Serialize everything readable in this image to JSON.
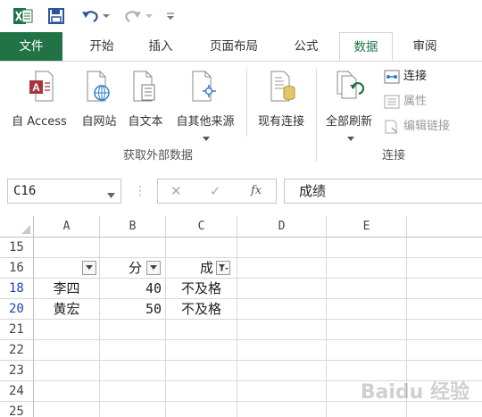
{
  "qat": {
    "icons": [
      "excel-logo-icon",
      "save-icon",
      "undo-icon",
      "redo-icon",
      "customize-qat-icon"
    ]
  },
  "tabs": [
    "文件",
    "开始",
    "插入",
    "页面布局",
    "公式",
    "数据",
    "审阅"
  ],
  "active_tab": "数据",
  "ribbon": {
    "get_external": {
      "from_access": "自 Access",
      "from_web": "自网站",
      "from_text": "自文本",
      "from_other": "自其他来源",
      "group_label": "获取外部数据"
    },
    "existing_connections": "现有连接",
    "connections": {
      "refresh_all": "全部刷新",
      "connections": "连接",
      "properties": "属性",
      "edit_links": "编辑链接",
      "group_label": "连接"
    }
  },
  "formula_bar": {
    "name_box": "C16",
    "cancel_glyph": "✕",
    "enter_glyph": "✓",
    "fx_glyph": "fx",
    "content": "成绩"
  },
  "grid": {
    "columns": [
      "A",
      "B",
      "C",
      "D",
      "E"
    ],
    "rows": [
      {
        "num": "15",
        "filtered": false,
        "a": "",
        "b": "",
        "c": ""
      },
      {
        "num": "16",
        "filtered": false,
        "a": "",
        "b": "分",
        "c": "成"
      },
      {
        "num": "18",
        "filtered": true,
        "a": "李四",
        "b": "40",
        "c": "不及格"
      },
      {
        "num": "20",
        "filtered": true,
        "a": "黄宏",
        "b": "50",
        "c": "不及格"
      },
      {
        "num": "21",
        "filtered": false,
        "a": "",
        "b": "",
        "c": ""
      },
      {
        "num": "22",
        "filtered": false,
        "a": "",
        "b": "",
        "c": ""
      },
      {
        "num": "23",
        "filtered": false,
        "a": "",
        "b": "",
        "c": ""
      },
      {
        "num": "24",
        "filtered": false,
        "a": "",
        "b": "",
        "c": ""
      },
      {
        "num": "25",
        "filtered": false,
        "a": "",
        "b": "",
        "c": ""
      }
    ]
  },
  "watermark": "Baidu 经验",
  "colors": {
    "excel_green": "#217346",
    "filtered_row": "#1f3fbf",
    "access_red": "#a4373a",
    "qat_blue": "#2b579a"
  }
}
